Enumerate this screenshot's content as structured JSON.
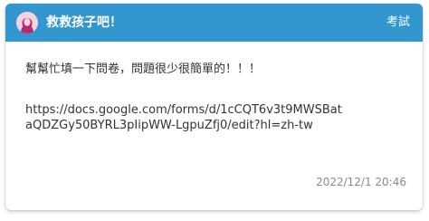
{
  "header": {
    "avatar_icon": "female-profile-icon",
    "board_title": "救救孩子吧！",
    "category_tag": "考試",
    "bar_color": "#3397cf"
  },
  "post": {
    "lines": [
      "幫幫忙填一下問卷，問題很少很簡單的！！！",
      "https://docs.google.com/forms/d/1cCQT6v3t9MWSBat",
      "aQDZGy50BYRL3pIipWW-LgpuZfj0/edit?hl=zh-tw"
    ],
    "timestamp": "2022/12/1 20:46"
  }
}
